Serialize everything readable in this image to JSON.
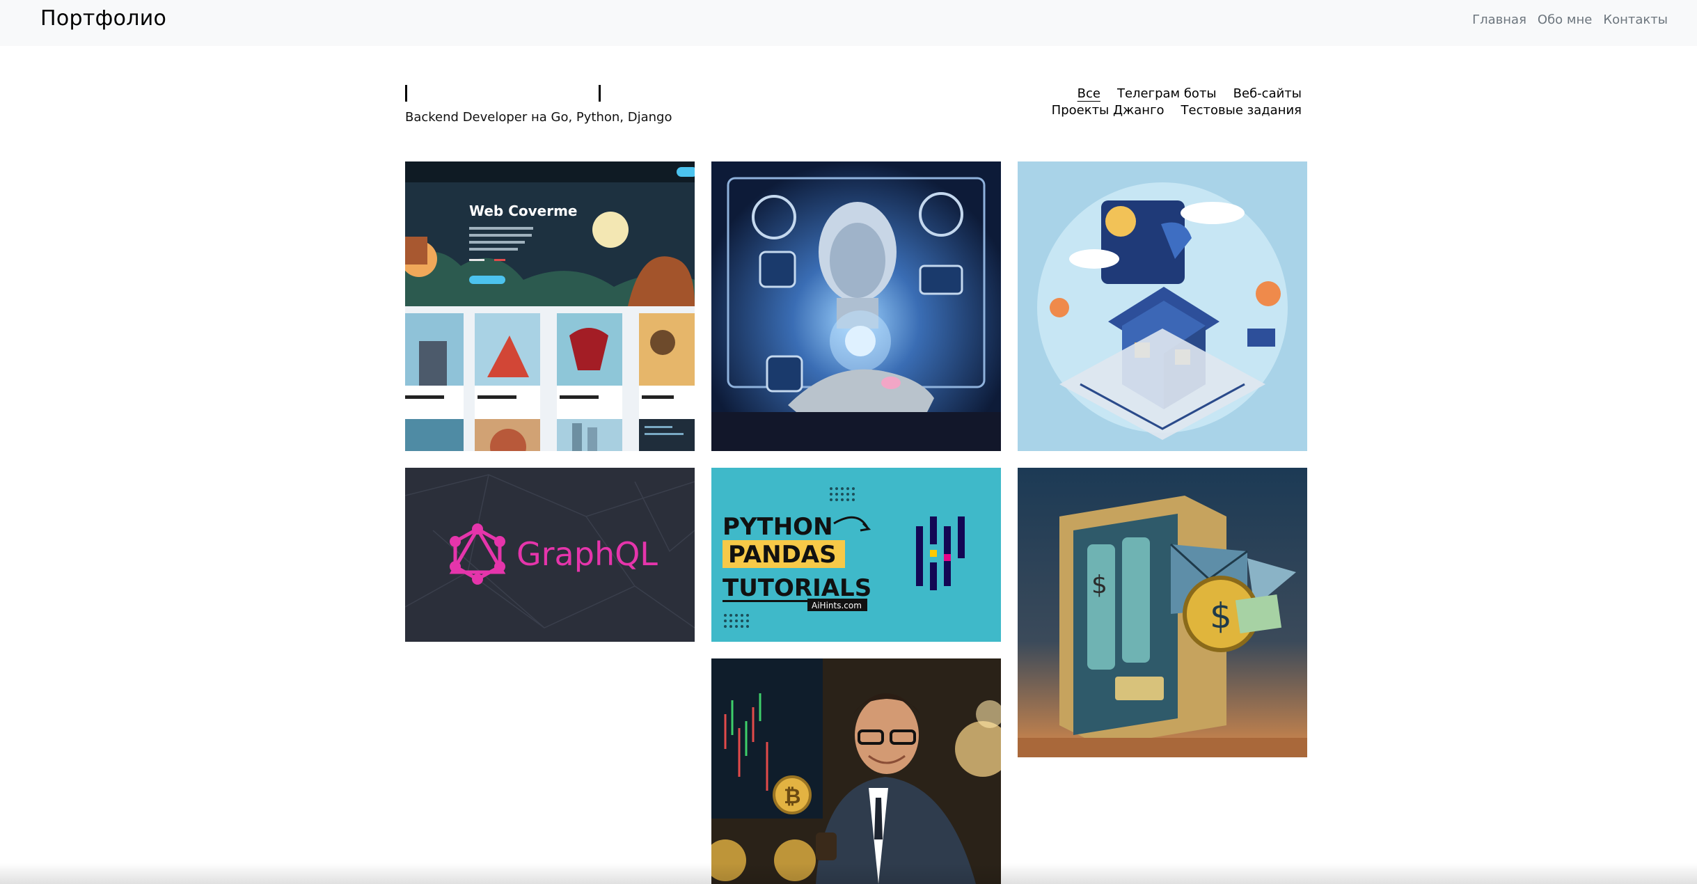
{
  "navbar": {
    "brand": "Портфолио",
    "links": [
      "Главная",
      "Обо мне",
      "Контакты"
    ]
  },
  "profile": {
    "subtitle": "Backend Developer на Go, Python, Django"
  },
  "filters": {
    "items": [
      "Все",
      "Телеграм боты",
      "Веб-сайты",
      "Проекты Джанго",
      "Тестовые задания"
    ],
    "active": "Все"
  },
  "portfolio": {
    "tiles": [
      {
        "name": "web-coverme",
        "title": "Web Coverme"
      },
      {
        "name": "ai-robot"
      },
      {
        "name": "isometric-house"
      },
      {
        "name": "graphql",
        "title": "GraphQL"
      },
      {
        "name": "python-pandas",
        "line1": "PYTHON",
        "line2": "PANDAS",
        "line3": "TUTORIALS",
        "tag": "AiHints.com"
      },
      {
        "name": "crypto-machine"
      },
      {
        "name": "bitcoin-trader"
      }
    ]
  },
  "colors": {
    "navbar_bg": "#f8f9fa",
    "nav_link": "#6c757d",
    "graphql_pink": "#e535ab",
    "pandas_teal": "#3fb9c9"
  }
}
